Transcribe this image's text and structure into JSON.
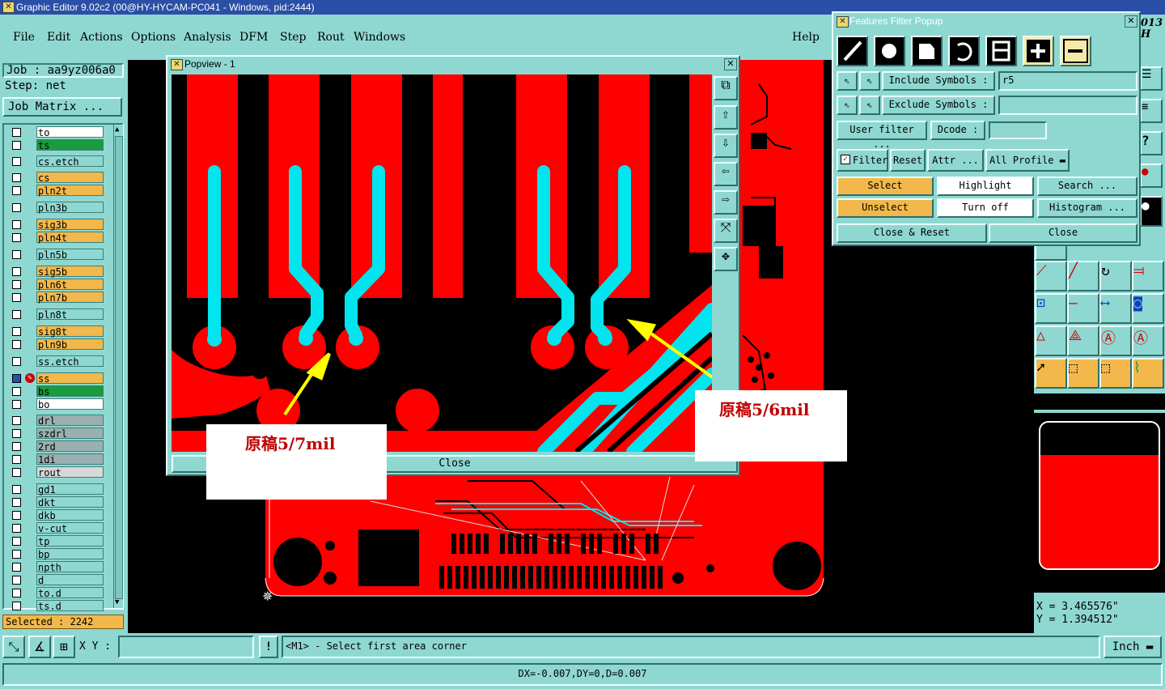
{
  "window": {
    "title": "Graphic Editor 9.02c2 (00@HY-HYCAM-PC041 - Windows, pid:2444)"
  },
  "menu": {
    "items": [
      "File",
      "Edit",
      "Actions",
      "Options",
      "Analysis",
      "DFM",
      "Step",
      "Rout",
      "Windows"
    ],
    "help": "Help"
  },
  "job": {
    "label": "Job : aa9yz006a0",
    "step": "Step: net",
    "matrix_button": "Job Matrix ..."
  },
  "layers": [
    {
      "name": "to",
      "color": "#ffffff"
    },
    {
      "name": "ts",
      "color": "#1a9c3c"
    },
    {
      "name": "cs.etch",
      "color": "#8fd8d2"
    },
    {
      "name": "cs",
      "color": "#f2b84b"
    },
    {
      "name": "pln2t",
      "color": "#f2b84b"
    },
    {
      "name": "pln3b",
      "color": "#8fd8d2"
    },
    {
      "name": "sig3b",
      "color": "#f2b84b"
    },
    {
      "name": "pln4t",
      "color": "#f2b84b"
    },
    {
      "name": "pln5b",
      "color": "#8fd8d2"
    },
    {
      "name": "sig5b",
      "color": "#f2b84b"
    },
    {
      "name": "pln6t",
      "color": "#f2b84b"
    },
    {
      "name": "pln7b",
      "color": "#f2b84b"
    },
    {
      "name": "pln8t",
      "color": "#8fd8d2"
    },
    {
      "name": "sig8t",
      "color": "#f2b84b"
    },
    {
      "name": "pln9b",
      "color": "#f2b84b"
    },
    {
      "name": "ss.etch",
      "color": "#8fd8d2"
    },
    {
      "name": "ss",
      "color": "#f2b84b"
    },
    {
      "name": "bs",
      "color": "#1a9c3c"
    },
    {
      "name": "bo",
      "color": "#ffffff"
    },
    {
      "name": "drl",
      "color": "#9ab0b0"
    },
    {
      "name": "szdrl",
      "color": "#9ab0b0"
    },
    {
      "name": "2rd",
      "color": "#9ab0b0"
    },
    {
      "name": "1di",
      "color": "#9ab0b0"
    },
    {
      "name": "rout",
      "color": "#d8d8d8"
    },
    {
      "name": "gd1",
      "color": "#8fd8d2"
    },
    {
      "name": "dkt",
      "color": "#8fd8d2"
    },
    {
      "name": "dkb",
      "color": "#8fd8d2"
    },
    {
      "name": "v-cut",
      "color": "#8fd8d2"
    },
    {
      "name": "tp",
      "color": "#8fd8d2"
    },
    {
      "name": "bp",
      "color": "#8fd8d2"
    },
    {
      "name": "npth",
      "color": "#8fd8d2"
    },
    {
      "name": "d",
      "color": "#8fd8d2"
    },
    {
      "name": "to.d",
      "color": "#8fd8d2"
    },
    {
      "name": "ts.d",
      "color": "#8fd8d2"
    }
  ],
  "selected": "Selected : 2242",
  "popview": {
    "title": "Popview - 1",
    "close_label": "Close"
  },
  "callouts": {
    "left": "原稿5/7mil",
    "right": "原稿5/6mil"
  },
  "features_filter": {
    "title": "Features Filter Popup",
    "include_label": "Include Symbols :",
    "include_value": "r5",
    "exclude_label": "Exclude Symbols :",
    "exclude_value": "",
    "user_filter": "User filter ...",
    "dcode": "Dcode :",
    "filter": "Filter",
    "reset": "Reset",
    "attr": "Attr ...",
    "all_profile": "All Profile",
    "select": "Select",
    "highlight": "Highlight",
    "search": "Search ...",
    "unselect": "Unselect",
    "turn_off": "Turn off",
    "histogram": "Histogram ...",
    "close_reset": "Close & Reset",
    "close": "Close"
  },
  "right_panel": {
    "edge_text_1": "013",
    "edge_text_2": "H"
  },
  "coords": {
    "x": "X = 3.465576\"",
    "y": "Y = 1.394512\""
  },
  "status": {
    "xy_label": "X Y :",
    "xy_value": "",
    "message": "<M1> - Select first area corner",
    "units": "Inch",
    "delta": "DX=-0.007,DY=0,D=0.007"
  },
  "colors": {
    "copper": "#ff0000",
    "trace": "#00e5ee",
    "accent": "#2b4fa6",
    "arrow": "#ffff00",
    "callout_text": "#c00000"
  }
}
